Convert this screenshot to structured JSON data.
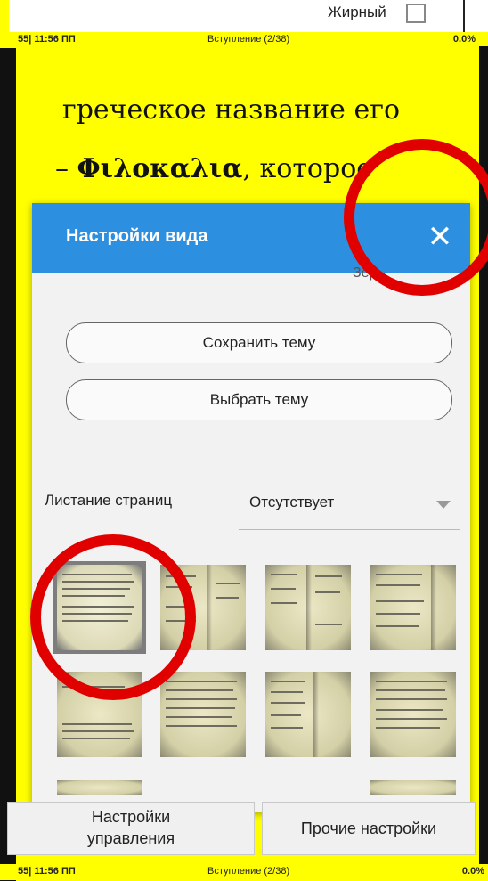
{
  "top_panel": {
    "bold_label": "Жирный"
  },
  "status_top": {
    "page_time": "55| 11:56 ПП",
    "chapter": "Вступление (2/38)",
    "progress": "0.0%"
  },
  "book_text": {
    "line1": "греческое  название  его",
    "line2_dash": "–",
    "line2_bold": "Φιλοκαλια",
    "line2_rest": ",      которое"
  },
  "dialog": {
    "title": "Настройки вида",
    "close_icon": "close-icon",
    "hidden_text": "Зер",
    "save_theme": "Сохранить тему",
    "choose_theme": "Выбрать тему",
    "page_flip_label": "Листание страниц",
    "page_flip_value": "Отсутствует",
    "themes": [
      "theme-1",
      "theme-2",
      "theme-3",
      "theme-4",
      "theme-5",
      "theme-6",
      "theme-7",
      "theme-8",
      "theme-9",
      "theme-10"
    ],
    "selected_theme_index": 0,
    "control_settings": "Настройки управления",
    "other_settings": "Прочие настройки"
  },
  "status_bottom": {
    "page_time": "55| 11:56 ПП",
    "chapter": "Вступление (2/38)",
    "progress": "0.0%"
  },
  "colors": {
    "page_background": "#ffff00",
    "dialog_header": "#2d8fe0",
    "annotation": "#e00000"
  }
}
